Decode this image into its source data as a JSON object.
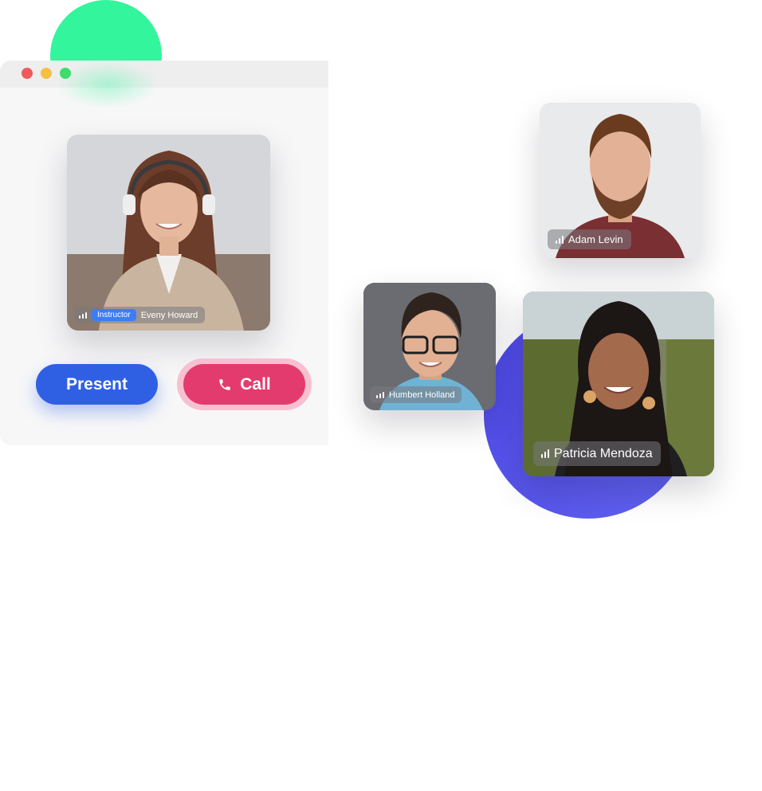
{
  "window": {
    "controls": [
      "close",
      "minimize",
      "maximize"
    ]
  },
  "participants": {
    "instructor": {
      "role": "Instructor",
      "name": "Eveny Howard"
    },
    "adam": {
      "name": "Adam Levin"
    },
    "humbert": {
      "name": "Humbert Holland"
    },
    "patricia": {
      "name": "Patricia Mendoza"
    }
  },
  "actions": {
    "present_label": "Present",
    "call_label": "Call",
    "call_icon": "phone-icon"
  },
  "icons": {
    "signal": "signal-bars-icon"
  },
  "colors": {
    "present_button": "#2f60e4",
    "call_button": "#e43b6e",
    "role_badge": "#3d7cf5",
    "accent_green": "#33f59b",
    "accent_purple": "#4e46e6"
  }
}
